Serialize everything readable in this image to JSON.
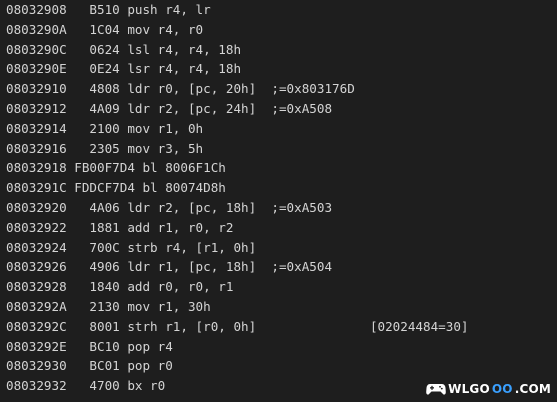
{
  "disassembly": {
    "lines": [
      "08032908   B510 push r4, lr",
      "0803290A   1C04 mov r4, r0",
      "0803290C   0624 lsl r4, r4, 18h",
      "0803290E   0E24 lsr r4, r4, 18h",
      "08032910   4808 ldr r0, [pc, 20h]  ;=0x803176D",
      "08032912   4A09 ldr r2, [pc, 24h]  ;=0xA508",
      "08032914   2100 mov r1, 0h",
      "08032916   2305 mov r3, 5h",
      "08032918 FB00F7D4 bl 8006F1Ch",
      "0803291C FDDCF7D4 bl 80074D8h",
      "08032920   4A06 ldr r2, [pc, 18h]  ;=0xA503",
      "08032922   1881 add r1, r0, r2",
      "08032924   700C strb r4, [r1, 0h]",
      "08032926   4906 ldr r1, [pc, 18h]  ;=0xA504",
      "08032928   1840 add r0, r0, r1",
      "0803292A   2130 mov r1, 30h",
      "0803292C   8001 strh r1, [r0, 0h]               [02024484=30]",
      "0803292E   BC10 pop r4",
      "08032930   BC01 pop r0",
      "08032932   4700 bx r0"
    ]
  },
  "watermark": {
    "icon": "gamepad-icon",
    "part1": "WLGO",
    "part2": "OO",
    "part3": ".COM",
    "color_primary": "#ffffff",
    "color_accent": "#3aa0ff"
  }
}
